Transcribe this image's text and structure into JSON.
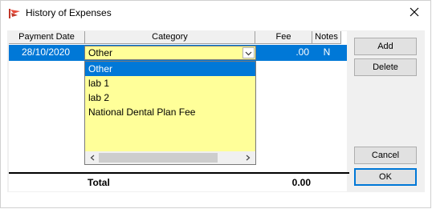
{
  "window": {
    "title": "History of Expenses"
  },
  "grid": {
    "columns": [
      "Payment Date",
      "Category",
      "Fee",
      "Notes"
    ],
    "selected_row": {
      "payment_date": "28/10/2020",
      "category": "Other",
      "fee": ".00",
      "notes": "N"
    }
  },
  "category_dropdown": {
    "items": [
      "Other",
      "lab 1",
      "lab 2",
      "National Dental Plan Fee"
    ],
    "selected_index": 0
  },
  "totals": {
    "label": "Total",
    "value": "0.00"
  },
  "buttons": {
    "add": "Add",
    "delete": "Delete",
    "cancel": "Cancel",
    "ok": "OK"
  },
  "colors": {
    "selection": "#0078d7",
    "combo_background": "#ffff99",
    "dialog_background": "#f0f0f0"
  }
}
